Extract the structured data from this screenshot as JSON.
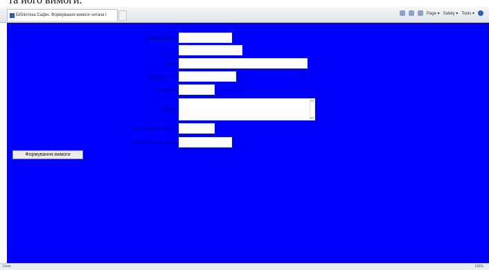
{
  "caption_fragment": "та його вимоги.",
  "browser": {
    "tab_title": "Бібліотека Сафін. Формування вимоги читача І",
    "commands": [
      "Page ▾",
      "Safety ▾",
      "Tools ▾"
    ]
  },
  "form": {
    "fields": [
      {
        "label": "Кл.ка кальки"
      },
      {
        "label": "Автор"
      },
      {
        "label": "Назва"
      },
      {
        "label": "Видавництво"
      },
      {
        "label": "Рік видання"
      },
      {
        "label": "Місце"
      },
      {
        "label": "Кількість екземплярів"
      },
      {
        "label": "Кількість посилання"
      }
    ],
    "submit_label": "Формування вимоги"
  },
  "status": {
    "left": "Done",
    "right": "100%"
  },
  "colors": {
    "page_background": "#0000ff",
    "label_text": "#00005a"
  }
}
